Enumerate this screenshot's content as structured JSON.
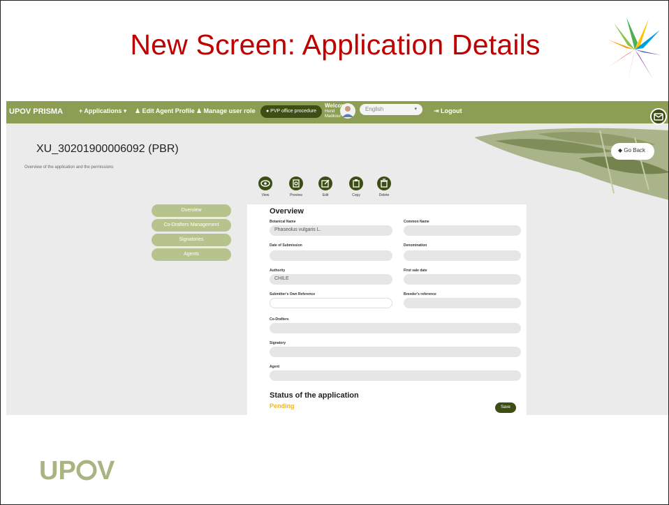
{
  "slide": {
    "title": "New Screen: Application Details",
    "footer_logo": "UPOV"
  },
  "navbar": {
    "brand": "UPOV PRISMA",
    "items": [
      {
        "label": "+ Applications ▾",
        "icon": "plus-icon"
      },
      {
        "label": "♟ Edit Agent Profile",
        "icon": "user-icon"
      },
      {
        "label": "♟ Manage user role",
        "icon": "user-icon"
      }
    ],
    "procedure_button": "● PVP office procedure",
    "welcome": {
      "greeting": "Welcome",
      "name_line1": "Hend",
      "name_line2": "Madkour"
    },
    "language": "English",
    "logout": "⇥ Logout",
    "mail_icon": "mail-icon"
  },
  "header": {
    "title": "XU_30201900006092 (PBR)",
    "subtitle": "Overview of the application and the permissions",
    "go_back": "Go Back"
  },
  "actions": [
    {
      "label": "View",
      "icon": "eye-icon"
    },
    {
      "label": "Preview",
      "icon": "preview-icon"
    },
    {
      "label": "Edit",
      "icon": "edit-icon"
    },
    {
      "label": "Copy",
      "icon": "copy-icon"
    },
    {
      "label": "Delete",
      "icon": "trash-icon"
    }
  ],
  "sidenav": {
    "items": [
      "Overview",
      "Co-Drafters Management",
      "Signatories",
      "Agents"
    ]
  },
  "overview": {
    "title": "Overview",
    "fields": {
      "botanical_name": {
        "label": "Botanical Name",
        "value": "Phaseolus vulgaris L."
      },
      "common_name": {
        "label": "Common Name",
        "value": ""
      },
      "date_of_submission": {
        "label": "Date of Submission",
        "value": ""
      },
      "denomination": {
        "label": "Denomination",
        "value": ""
      },
      "authority": {
        "label": "Authority",
        "value": "CHILE"
      },
      "first_sale_date": {
        "label": "First sale date",
        "value": ""
      },
      "submitter_reference": {
        "label": "Submitter's Own Reference",
        "value": ""
      },
      "breeder_reference": {
        "label": "Breeder's reference",
        "value": ""
      },
      "co_drafters": {
        "label": "Co-Drafters",
        "value": ""
      },
      "signatory": {
        "label": "Signatory",
        "value": ""
      },
      "agent": {
        "label": "Agent",
        "value": ""
      }
    },
    "status_title": "Status of the application",
    "status_value": "Pending",
    "save_label": "Save"
  },
  "colors": {
    "slide_title": "#c00000",
    "navbar": "#8c9e53",
    "dark_green": "#3d4e14",
    "sidenav": "#b7c38d",
    "pending": "#f0b526"
  }
}
